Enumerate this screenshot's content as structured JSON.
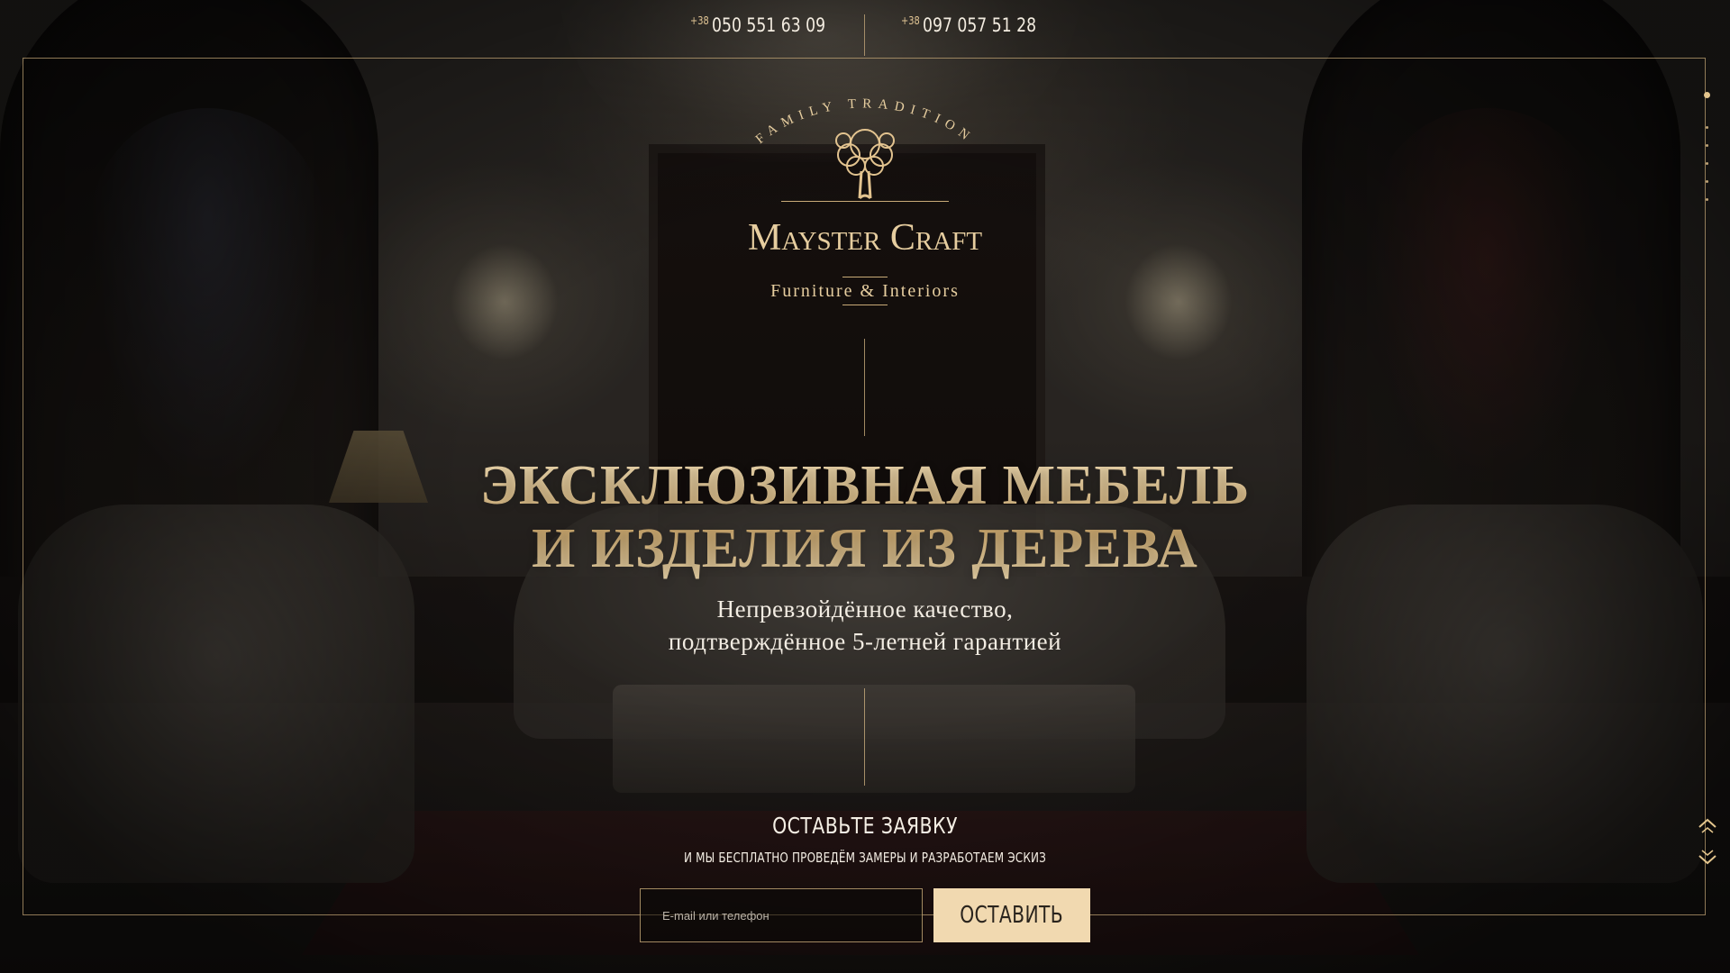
{
  "header": {
    "phones": [
      {
        "code": "+38",
        "number": "050 551 63 09"
      },
      {
        "code": "+38",
        "number": "097 057 51 28"
      }
    ]
  },
  "logo": {
    "arc_text": "FAMILY TRADITION",
    "brand": "Mayster Craft",
    "tagline": "Furniture & Interiors",
    "icon": "tree-icon"
  },
  "hero": {
    "headline_line1": "ЭКСКЛЮЗИВНАЯ МЕБЕЛЬ",
    "headline_line2": "И ИЗДЕЛИЯ ИЗ ДЕРЕВА",
    "sub_line1": "Непревзойдённое качество,",
    "sub_line2": "подтверждённое 5-летней гарантией"
  },
  "form": {
    "title": "ОСТАВЬТЕ ЗАЯВКУ",
    "subtitle": "И МЫ БЕСПЛАТНО ПРОВЕДЁМ  ЗАМЕРЫ И РАЗРАБОТАЕМ ЭСКИЗ",
    "input_placeholder": "E-mail или телефон",
    "input_value": "",
    "submit_label": "ОСТАВИТЬ"
  },
  "sidenav": {
    "dots": 6,
    "active_index": 0,
    "icons": [
      "chevron-up-icon",
      "chevron-down-icon"
    ]
  },
  "colors": {
    "gold": "#e6cd9f",
    "gold_line": "#c9ab78",
    "button_bg": "#f1d9b0",
    "text_light": "#f2ece2"
  }
}
